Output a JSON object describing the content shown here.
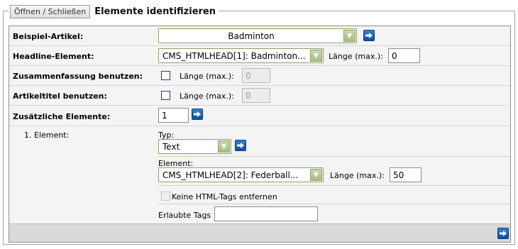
{
  "legend": {
    "toggle_label": "Öffnen / Schließen",
    "title": "Elemente identifizieren"
  },
  "rows": {
    "example_article": {
      "label": "Beispiel-Artikel:",
      "value": "Badminton"
    },
    "headline": {
      "label": "Headline-Element:",
      "value": "CMS_HTMLHEAD[1]: Badminton...",
      "length_label": "Länge (max.):",
      "length_value": "0"
    },
    "summary": {
      "label": "Zusammenfassung benutzen:",
      "length_label": "Länge (max.):",
      "length_value": "0",
      "checked": false
    },
    "article_title": {
      "label": "Artikeltitel benutzen:",
      "length_label": "Länge (max.):",
      "length_value": "0",
      "checked": false
    },
    "additional": {
      "label": "Zusätzliche Elemente:",
      "value": "1"
    }
  },
  "element1": {
    "label": "1. Element:",
    "type_label": "Typ:",
    "type_value": "Text",
    "element_label": "Element:",
    "element_value": "CMS_HTMLHEAD[2]: Federball...",
    "length_label": "Länge (max.):",
    "length_value": "50",
    "keep_tags_label": "Keine HTML-Tags entfernen",
    "allowed_tags_label": "Erlaubte Tags",
    "allowed_tags_value": ""
  },
  "colors": {
    "go_button": "#1f63b5",
    "select_border": "#8ea26a",
    "panel_bg": "#f4f4f4"
  },
  "icons": {
    "go": "arrow-right-icon",
    "select_arrow": "chevron-down-icon"
  }
}
